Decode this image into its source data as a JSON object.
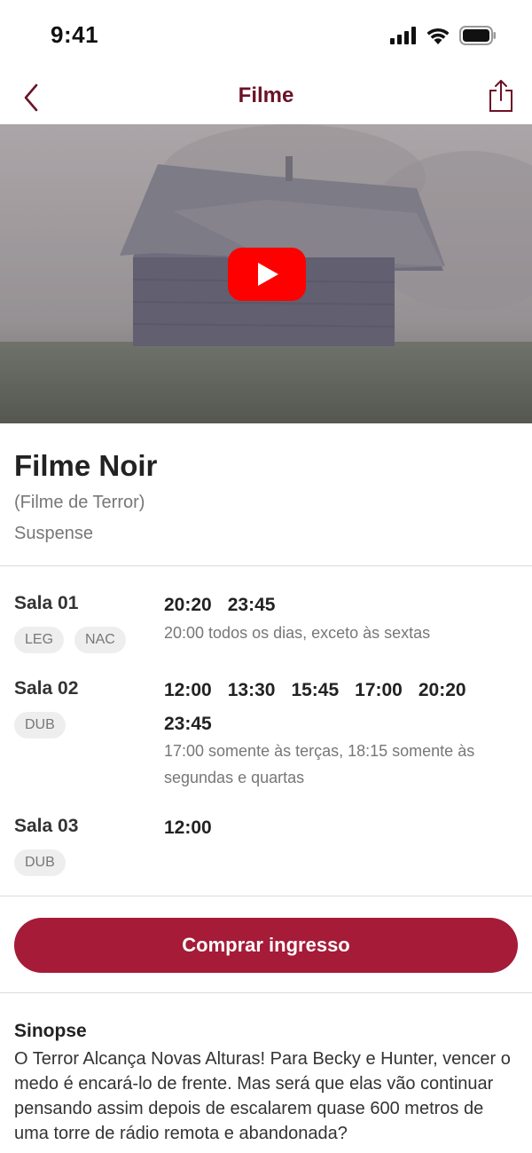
{
  "status": {
    "time": "9:41"
  },
  "nav": {
    "title": "Filme"
  },
  "movie": {
    "title": "Filme Noir",
    "subtitle": "(Filme de Terror)",
    "genre": "Suspense"
  },
  "salas": [
    {
      "name": "Sala 01",
      "tags": [
        "LEG",
        "NAC"
      ],
      "times": [
        "20:20",
        "23:45"
      ],
      "note": "20:00 todos os dias, exceto às sextas"
    },
    {
      "name": "Sala 02",
      "tags": [
        "DUB"
      ],
      "times": [
        "12:00",
        "13:30",
        "15:45",
        "17:00",
        "20:20",
        "23:45"
      ],
      "note": "17:00 somente às terças, 18:15 somente às segundas e quartas"
    },
    {
      "name": "Sala 03",
      "tags": [
        "DUB"
      ],
      "times": [
        "12:00"
      ],
      "note": ""
    }
  ],
  "buy_label": "Comprar ingresso",
  "sinopse": {
    "title": "Sinopse",
    "text": "O Terror Alcança Novas Alturas! Para Becky e Hunter, vencer o medo é encará-lo de frente. Mas será que elas vão continuar pensando assim depois de escalarem quase 600 metros de uma torre de rádio remota e abandonada?"
  },
  "colors": {
    "accent": "#a51b38",
    "title": "#6b1226",
    "youtube": "#ff0000"
  },
  "icons": [
    "back-chevron-icon",
    "share-icon",
    "play-icon",
    "signal-icon",
    "wifi-icon",
    "battery-icon"
  ]
}
